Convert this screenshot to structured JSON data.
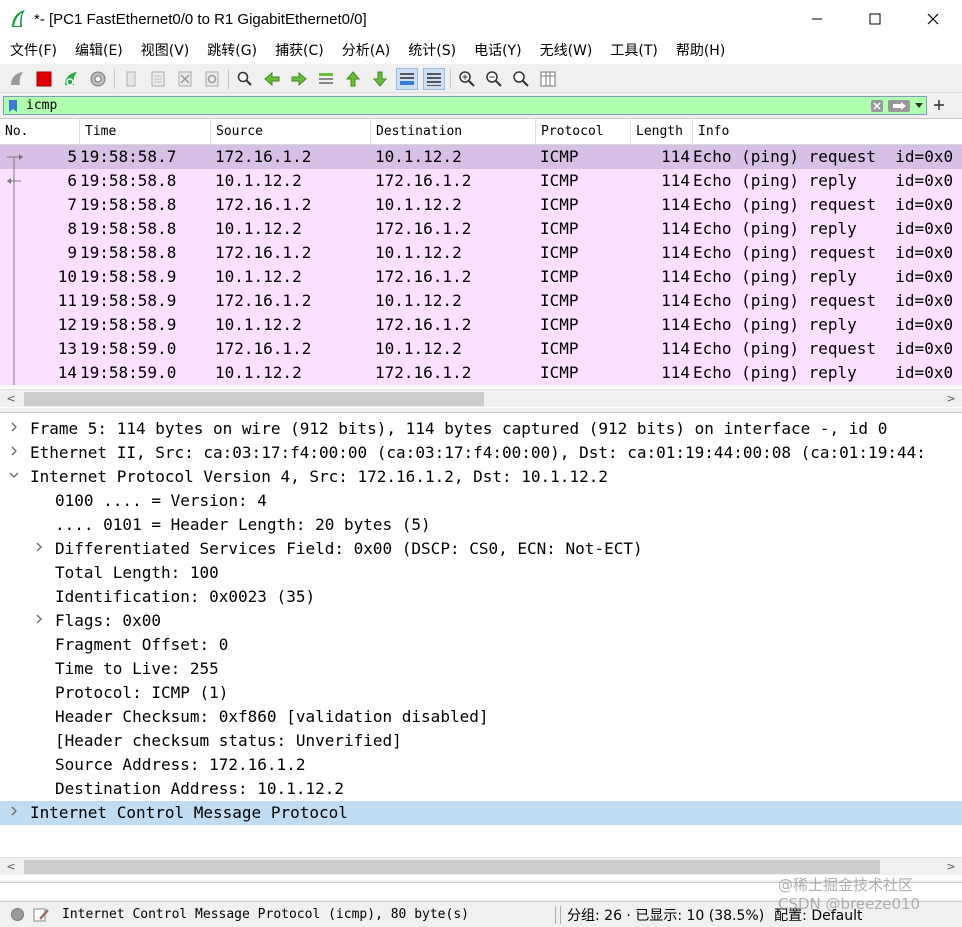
{
  "window": {
    "title": "*- [PC1 FastEthernet0/0 to R1 GigabitEthernet0/0]",
    "icon": "wireshark-fin-icon",
    "controls": [
      "minimize-icon",
      "maximize-icon",
      "close-icon"
    ]
  },
  "menu": [
    {
      "label": "文件(F)"
    },
    {
      "label": "编辑(E)"
    },
    {
      "label": "视图(V)"
    },
    {
      "label": "跳转(G)"
    },
    {
      "label": "捕获(C)"
    },
    {
      "label": "分析(A)"
    },
    {
      "label": "统计(S)"
    },
    {
      "label": "电话(Y)"
    },
    {
      "label": "无线(W)"
    },
    {
      "label": "工具(T)"
    },
    {
      "label": "帮助(H)"
    }
  ],
  "toolbar": {
    "icons": [
      "start-capture-icon",
      "stop-capture-icon",
      "restart-capture-icon",
      "capture-options-icon",
      "open-file-icon",
      "save-file-icon",
      "close-file-icon",
      "reload-file-icon",
      "find-packet-icon",
      "go-back-icon",
      "go-forward-icon",
      "go-to-packet-icon",
      "go-first-icon",
      "go-last-icon",
      "auto-scroll-icon",
      "colorize-icon",
      "zoom-in-icon",
      "zoom-out-icon",
      "zoom-normal-icon",
      "resize-columns-icon"
    ]
  },
  "filter": {
    "value": "icmp",
    "colors": {
      "valid": "#afffaf"
    }
  },
  "packet_list": {
    "columns": [
      "No.",
      "Time",
      "Source",
      "Destination",
      "Protocol",
      "Length",
      "Info"
    ],
    "rows": [
      {
        "no": "5",
        "time": "19:58:58.7",
        "src": "172.16.1.2",
        "dst": "10.1.12.2",
        "proto": "ICMP",
        "len": "114",
        "info": "Echo (ping) request  id=0x0"
      },
      {
        "no": "6",
        "time": "19:58:58.8",
        "src": "10.1.12.2",
        "dst": "172.16.1.2",
        "proto": "ICMP",
        "len": "114",
        "info": "Echo (ping) reply    id=0x0"
      },
      {
        "no": "7",
        "time": "19:58:58.8",
        "src": "172.16.1.2",
        "dst": "10.1.12.2",
        "proto": "ICMP",
        "len": "114",
        "info": "Echo (ping) request  id=0x0"
      },
      {
        "no": "8",
        "time": "19:58:58.8",
        "src": "10.1.12.2",
        "dst": "172.16.1.2",
        "proto": "ICMP",
        "len": "114",
        "info": "Echo (ping) reply    id=0x0"
      },
      {
        "no": "9",
        "time": "19:58:58.8",
        "src": "172.16.1.2",
        "dst": "10.1.12.2",
        "proto": "ICMP",
        "len": "114",
        "info": "Echo (ping) request  id=0x0"
      },
      {
        "no": "10",
        "time": "19:58:58.9",
        "src": "10.1.12.2",
        "dst": "172.16.1.2",
        "proto": "ICMP",
        "len": "114",
        "info": "Echo (ping) reply    id=0x0"
      },
      {
        "no": "11",
        "time": "19:58:58.9",
        "src": "172.16.1.2",
        "dst": "10.1.12.2",
        "proto": "ICMP",
        "len": "114",
        "info": "Echo (ping) request  id=0x0"
      },
      {
        "no": "12",
        "time": "19:58:58.9",
        "src": "10.1.12.2",
        "dst": "172.16.1.2",
        "proto": "ICMP",
        "len": "114",
        "info": "Echo (ping) reply    id=0x0"
      },
      {
        "no": "13",
        "time": "19:58:59.0",
        "src": "172.16.1.2",
        "dst": "10.1.12.2",
        "proto": "ICMP",
        "len": "114",
        "info": "Echo (ping) request  id=0x0"
      },
      {
        "no": "14",
        "time": "19:58:59.0",
        "src": "10.1.12.2",
        "dst": "172.16.1.2",
        "proto": "ICMP",
        "len": "114",
        "info": "Echo (ping) reply    id=0x0"
      }
    ],
    "selected_row": 0,
    "colors": {
      "row": "#fce0ff",
      "selected": "#d8bfe6"
    }
  },
  "details": {
    "rows": [
      {
        "text": "Frame 5: 114 bytes on wire (912 bits), 114 bytes captured (912 bits) on interface -, id 0",
        "level": 0,
        "arrow": "collapsed"
      },
      {
        "text": "Ethernet II, Src: ca:03:17:f4:00:00 (ca:03:17:f4:00:00), Dst: ca:01:19:44:00:08 (ca:01:19:44:",
        "level": 0,
        "arrow": "collapsed"
      },
      {
        "text": "Internet Protocol Version 4, Src: 172.16.1.2, Dst: 10.1.12.2",
        "level": 0,
        "arrow": "expanded"
      },
      {
        "text": "0100 .... = Version: 4",
        "level": 1,
        "arrow": "none"
      },
      {
        "text": ".... 0101 = Header Length: 20 bytes (5)",
        "level": 1,
        "arrow": "none"
      },
      {
        "text": "Differentiated Services Field: 0x00 (DSCP: CS0, ECN: Not-ECT)",
        "level": 1,
        "arrow": "collapsed"
      },
      {
        "text": "Total Length: 100",
        "level": 1,
        "arrow": "none"
      },
      {
        "text": "Identification: 0x0023 (35)",
        "level": 1,
        "arrow": "none"
      },
      {
        "text": "Flags: 0x00",
        "level": 1,
        "arrow": "collapsed"
      },
      {
        "text": "Fragment Offset: 0",
        "level": 1,
        "arrow": "none"
      },
      {
        "text": "Time to Live: 255",
        "level": 1,
        "arrow": "none"
      },
      {
        "text": "Protocol: ICMP (1)",
        "level": 1,
        "arrow": "none"
      },
      {
        "text": "Header Checksum: 0xf860 [validation disabled]",
        "level": 1,
        "arrow": "none"
      },
      {
        "text": "[Header checksum status: Unverified]",
        "level": 1,
        "arrow": "none"
      },
      {
        "text": "Source Address: 172.16.1.2",
        "level": 1,
        "arrow": "none"
      },
      {
        "text": "Destination Address: 10.1.12.2",
        "level": 1,
        "arrow": "none"
      },
      {
        "text": "Internet Control Message Protocol",
        "level": 0,
        "arrow": "collapsed"
      }
    ],
    "highlighted_row": 16,
    "colors": {
      "highlight": "#c0dcf3"
    }
  },
  "status": {
    "message": "Internet Control Message Protocol (icmp), 80 byte(s)",
    "stats": "分组: 26 · 已显示: 10 (38.5%)",
    "profile": "配置: Default"
  },
  "watermark": {
    "line1": "@稀土掘金技术社区",
    "line2": "CSDN @breeze010"
  }
}
